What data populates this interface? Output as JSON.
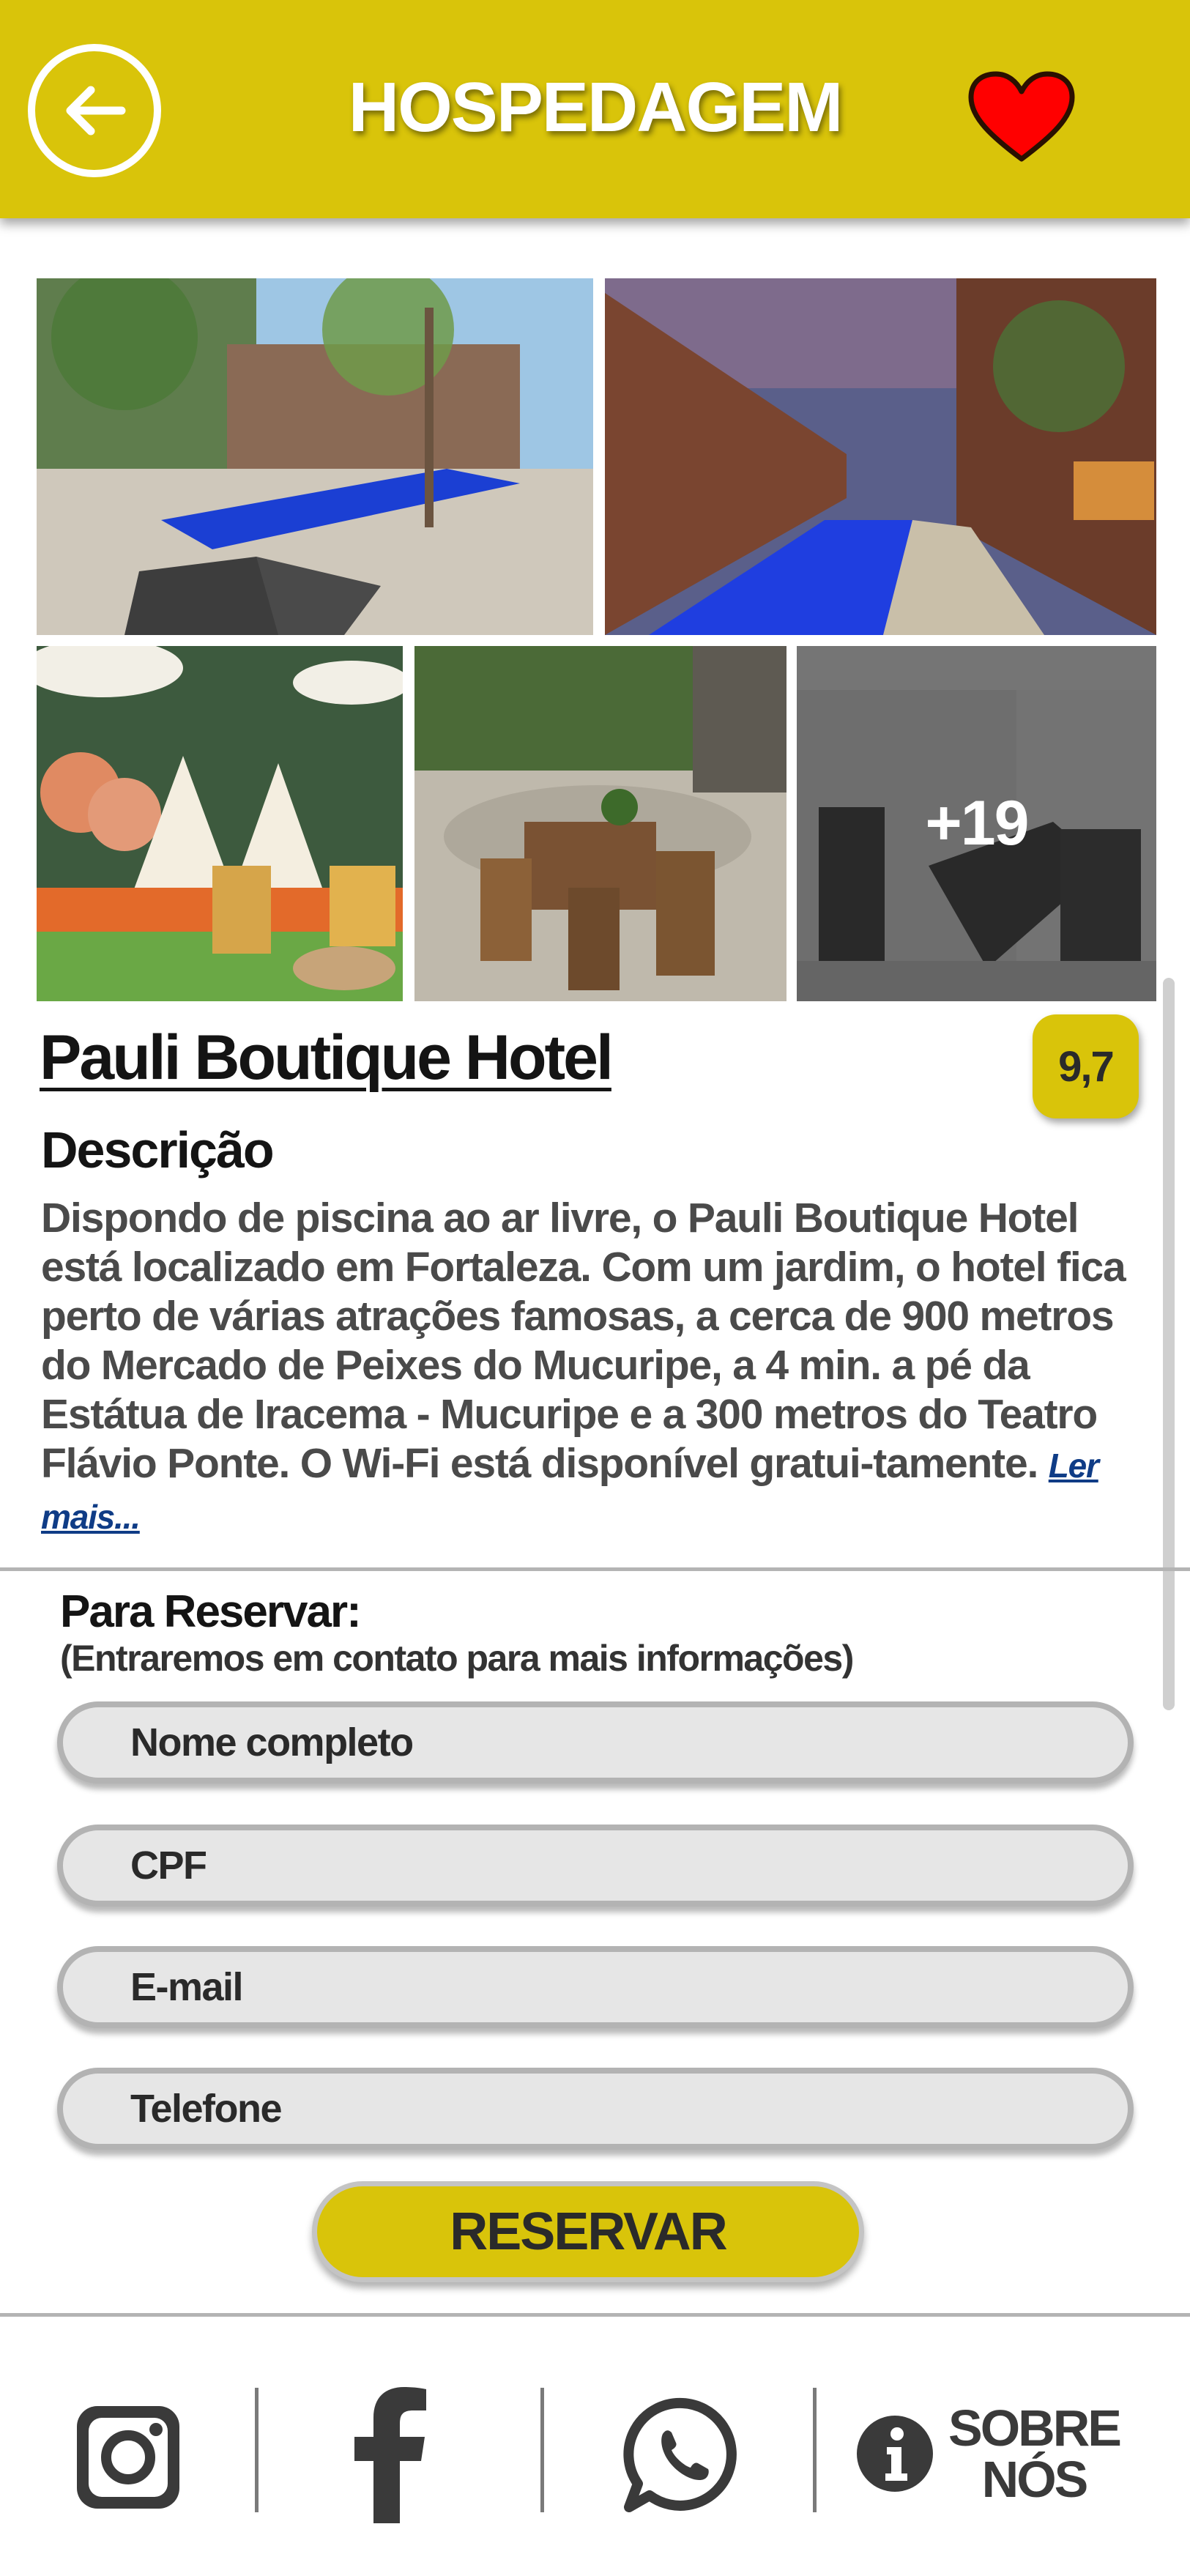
{
  "header": {
    "title": "HOSPEDAGEM",
    "back_icon": "arrow-left-icon",
    "favorite_icon": "heart-icon",
    "accent_color": "#d9c40a",
    "heart_color": "#ff0000"
  },
  "gallery": {
    "more_count": "+19",
    "photos": [
      "pool-courtyard",
      "pool-dusk",
      "kids-playroom",
      "garden-dining",
      "gym"
    ]
  },
  "hotel": {
    "name": "Pauli Boutique Hotel",
    "rating": "9,7"
  },
  "description": {
    "title": "Descrição",
    "text": "Dispondo de piscina ao ar livre, o Pauli Boutique Hotel está localizado em Fortaleza. Com um jardim, o hotel fica perto de várias atrações famosas, a cerca de 900 metros do Mercado de Peixes do Mucuripe, a 4 min.  a pé da Estátua de Iracema - Mucuripe e a 300 metros do Teatro Flávio Ponte. O Wi-Fi está disponível gratui-tamente.",
    "read_more": "Ler mais..."
  },
  "form": {
    "title": "Para Reservar:",
    "subtitle": "(Entraremos em contato para mais informações)",
    "fields": {
      "name": "Nome completo",
      "cpf": "CPF",
      "email": "E-mail",
      "phone": "Telefone"
    },
    "submit_label": "RESERVAR"
  },
  "footer": {
    "icons": [
      "instagram-icon",
      "facebook-icon",
      "whatsapp-icon",
      "info-icon"
    ],
    "about_line1": "SOBRE",
    "about_line2": "NÓS"
  }
}
